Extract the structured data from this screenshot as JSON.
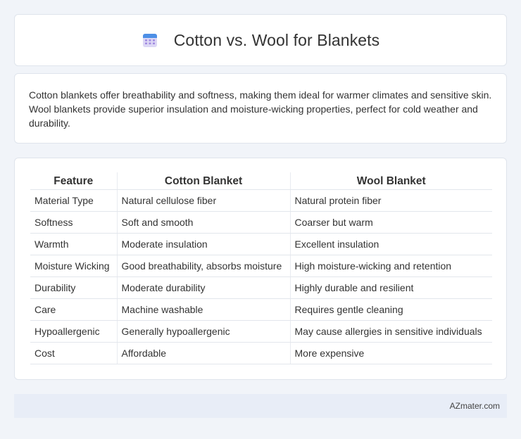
{
  "header": {
    "title": "Cotton vs. Wool for Blankets",
    "icon": "calendar-icon"
  },
  "summary": {
    "text": "Cotton blankets offer breathability and softness, making them ideal for warmer climates and sensitive skin. Wool blankets provide superior insulation and moisture-wicking properties, perfect for cold weather and durability."
  },
  "table": {
    "headers": [
      "Feature",
      "Cotton Blanket",
      "Wool Blanket"
    ],
    "rows": [
      [
        "Material Type",
        "Natural cellulose fiber",
        "Natural protein fiber"
      ],
      [
        "Softness",
        "Soft and smooth",
        "Coarser but warm"
      ],
      [
        "Warmth",
        "Moderate insulation",
        "Excellent insulation"
      ],
      [
        "Moisture Wicking",
        "Good breathability, absorbs moisture",
        "High moisture-wicking and retention"
      ],
      [
        "Durability",
        "Moderate durability",
        "Highly durable and resilient"
      ],
      [
        "Care",
        "Machine washable",
        "Requires gentle cleaning"
      ],
      [
        "Hypoallergenic",
        "Generally hypoallergenic",
        "May cause allergies in sensitive individuals"
      ],
      [
        "Cost",
        "Affordable",
        "More expensive"
      ]
    ]
  },
  "footer": {
    "text": "AZmater.com"
  }
}
